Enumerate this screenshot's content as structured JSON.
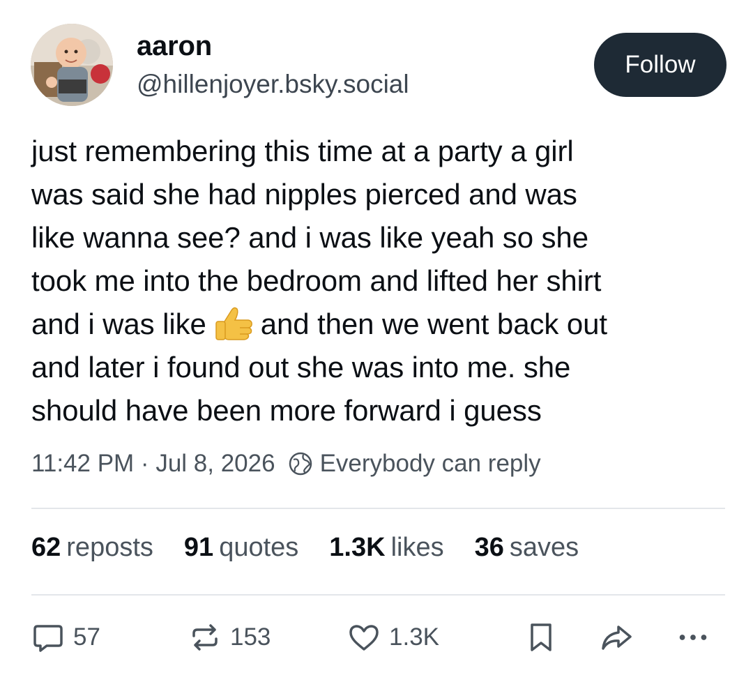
{
  "author": {
    "display_name": "aaron",
    "handle": "@hillenjoyer.bsky.social"
  },
  "follow_label": "Follow",
  "post": {
    "lines": [
      "just remembering this time at a party a girl",
      "was said she had nipples pierced and was",
      "like wanna see? and i was like yeah so she",
      "took me into the bedroom and lifted her shirt"
    ],
    "emoji_line_before": "and i was like",
    "emoji": "thumbs-up",
    "emoji_line_after": "and then we went back out",
    "lines_after": [
      "and later i found out she was into me. she",
      "should have been more forward i guess"
    ]
  },
  "meta": {
    "timestamp": "11:42 PM · Jul 8, 2026",
    "reply_setting": "Everybody can reply"
  },
  "stats": {
    "reposts_count": "62",
    "reposts_label": "reposts",
    "quotes_count": "91",
    "quotes_label": "quotes",
    "likes_count": "1.3K",
    "likes_label": "likes",
    "saves_count": "36",
    "saves_label": "saves"
  },
  "actions": {
    "reply_count": "57",
    "repost_count": "153",
    "like_count": "1.3K"
  },
  "colors": {
    "follow_button": "#1e2a35",
    "muted_text": "#4a535c",
    "divider": "#e3e6ea"
  }
}
